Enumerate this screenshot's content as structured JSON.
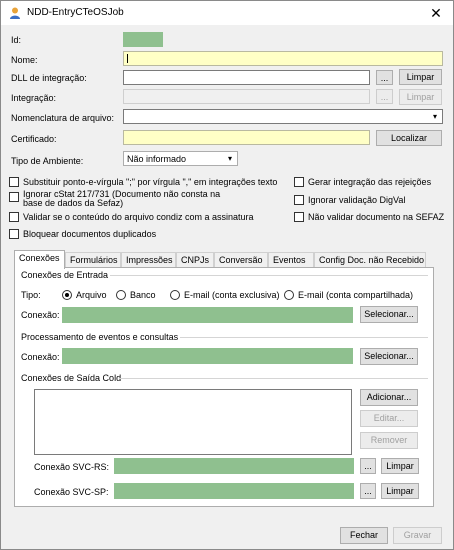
{
  "window": {
    "title": "NDD-EntryCTeOSJob",
    "close_glyph": "✕"
  },
  "form": {
    "id_label": "Id:",
    "nome_label": "Nome:",
    "dll_label": "DLL de integração:",
    "integracao_label": "Integração:",
    "nomenclatura_label": "Nomenclatura de arquivo:",
    "certificado_label": "Certificado:",
    "tipo_ambiente_label": "Tipo de Ambiente:",
    "tipo_ambiente_value": "Não informado",
    "ellipsis": "...",
    "limpar": "Limpar",
    "localizar": "Localizar"
  },
  "options": {
    "substituir": "Substituir ponto-e-vírgula \";\" por vírgula \",\" em integrações texto",
    "ignorar_cstat_line1": "Ignorar cStat 217/731 (Documento não consta na",
    "ignorar_cstat_line2": "base de dados da Sefaz)",
    "validar_conteudo": "Validar se o conteúdo do arquivo condiz com a assinatura",
    "bloquear": "Bloquear documentos duplicados",
    "gerar_rejeicoes": "Gerar integração das rejeições",
    "ignorar_digval": "Ignorar validação DigVal",
    "nao_validar_sefaz": "Não validar documento na SEFAZ"
  },
  "tabs": [
    "Conexões",
    "Formulários",
    "Impressões",
    "CNPJs",
    "Conversão",
    "Eventos",
    "Config Doc. não Recebido"
  ],
  "conexoes": {
    "entrada_title": "Conexões de Entrada",
    "tipo_label": "Tipo:",
    "radio_arquivo": "Arquivo",
    "radio_banco": "Banco",
    "radio_email_exclusiva": "E-mail (conta exclusiva)",
    "radio_email_compartilhada": "E-mail (conta compartilhada)",
    "conexao_label": "Conexão:",
    "selecionar": "Selecionar...",
    "processamento_title": "Processamento de eventos e consultas",
    "saida_title": "Conexões de Saída Cold",
    "adicionar": "Adicionar...",
    "editar": "Editar...",
    "remover": "Remover",
    "svc_rs_label": "Conexão SVC-RS:",
    "svc_sp_label": "Conexão SVC-SP:"
  },
  "footer": {
    "fechar": "Fechar",
    "gravar": "Gravar"
  },
  "colors": {
    "yellow_field": "#ffffc6",
    "green_field": "#8fc08f"
  },
  "icons": {
    "app": "user-icon",
    "dropdown": "chevron-down-icon"
  }
}
